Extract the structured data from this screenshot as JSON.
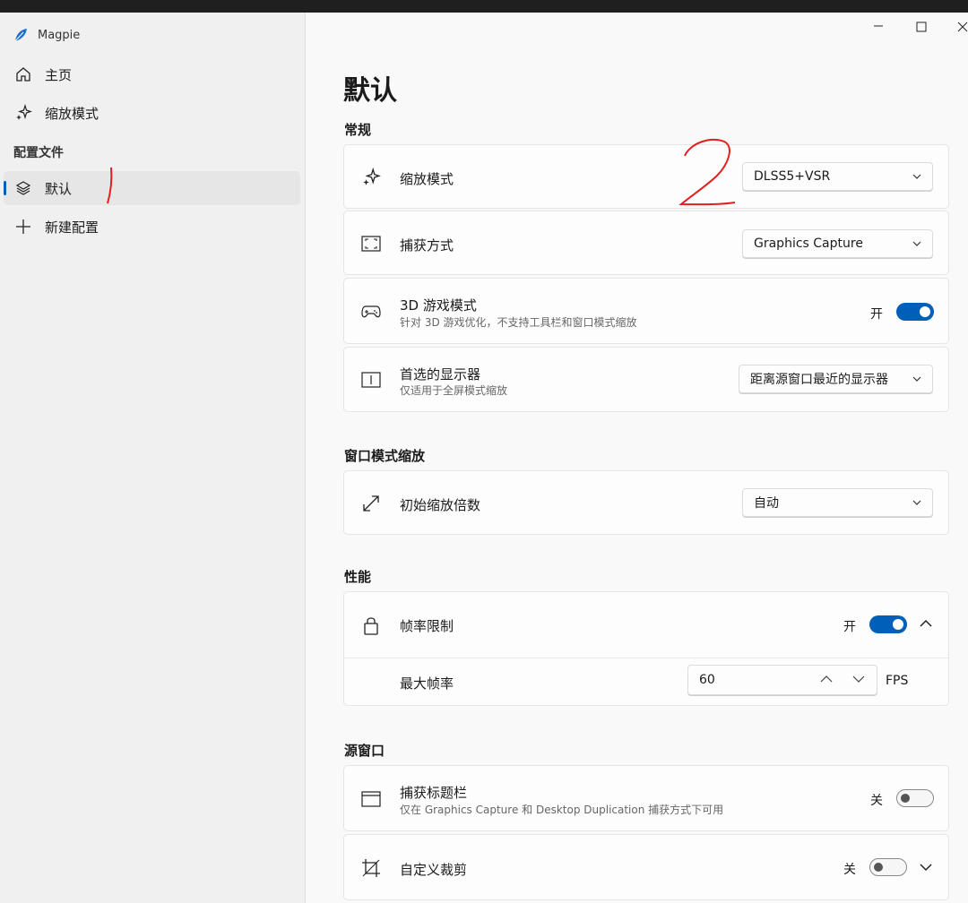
{
  "app": {
    "title": "Magpie"
  },
  "sidebar": {
    "items": [
      {
        "label": "主页",
        "icon": "home-icon"
      },
      {
        "label": "缩放模式",
        "icon": "sparkle-icon"
      }
    ],
    "section_label": "配置文件",
    "profiles": [
      {
        "label": "默认",
        "icon": "layers-icon",
        "active": true
      },
      {
        "label": "新建配置",
        "icon": "plus-icon"
      }
    ]
  },
  "window_controls": {
    "minimize": "—",
    "maximize": "☐",
    "close": "✕"
  },
  "page": {
    "title": "默认"
  },
  "sections": {
    "general": "常规",
    "windowed": "窗口模式缩放",
    "performance": "性能",
    "source": "源窗口"
  },
  "settings": {
    "scale_mode": {
      "title": "缩放模式",
      "value": "DLSS5+VSR"
    },
    "capture_method": {
      "title": "捕获方式",
      "value": "Graphics Capture"
    },
    "game_mode": {
      "title": "3D 游戏模式",
      "sub": "针对 3D 游戏优化，不支持工具栏和窗口模式缩放",
      "state_label": "开",
      "on": true
    },
    "display": {
      "title": "首选的显示器",
      "sub": "仅适用于全屏模式缩放",
      "value": "距离源窗口最近的显示器"
    },
    "initial_scale": {
      "title": "初始缩放倍数",
      "value": "自动"
    },
    "frame_limit": {
      "title": "帧率限制",
      "state_label": "开",
      "on": true
    },
    "max_fps": {
      "title": "最大帧率",
      "value": "60",
      "unit": "FPS"
    },
    "capture_titlebar": {
      "title": "捕获标题栏",
      "sub": "仅在 Graphics Capture 和 Desktop Duplication 捕获方式下可用",
      "state_label": "关",
      "on": false
    },
    "custom_crop": {
      "title": "自定义裁剪",
      "state_label": "关",
      "on": false
    }
  },
  "accent_color": "#005fb8"
}
